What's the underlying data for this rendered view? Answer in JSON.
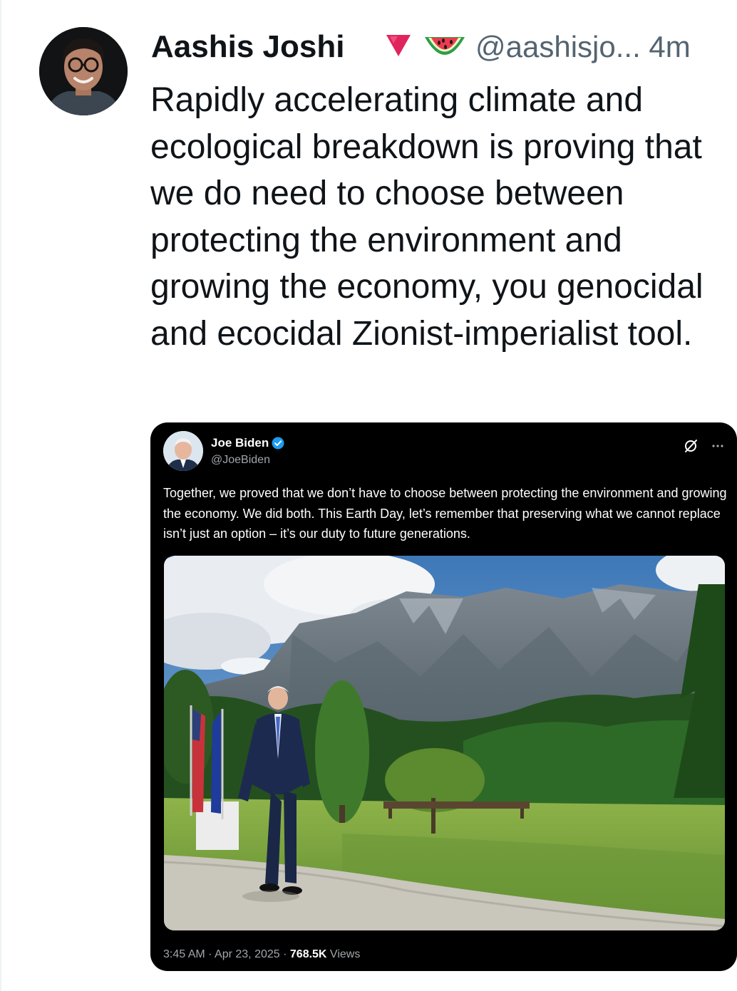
{
  "author": {
    "name": "Aashis Joshi",
    "handle": "@aashisjo...",
    "time": "4m"
  },
  "tweet": {
    "text": "Rapidly accelerating climate and ecological breakdown is proving that we do need to choose between protecting the environment and growing the economy, you genocidal and ecocidal Zionist-imperialist tool."
  },
  "quoted_tweet": {
    "name": "Joe Biden",
    "handle": "@JoeBiden",
    "text": "Together, we proved that we don’t have to choose between protecting the environment and growing the economy. We did both. This Earth Day, let’s remember that preserving what we cannot replace isn’t just an option – it’s our duty to future generations.",
    "timestamp": "3:45 AM · Apr 23, 2025 · ",
    "views_count": "768.5K",
    "views_label": " Views"
  },
  "icons": {
    "author_badges": [
      "red-triangle-icon",
      "watermelon-icon"
    ],
    "quote_badge": "verified-badge-icon",
    "quote_actions": [
      "grok-icon",
      "more-icon"
    ]
  },
  "colors": {
    "text": "#0f1419",
    "secondary": "#536471",
    "quote_bg": "#000000",
    "verified": "#1d9bf0",
    "badge_red": "#e0245e"
  }
}
